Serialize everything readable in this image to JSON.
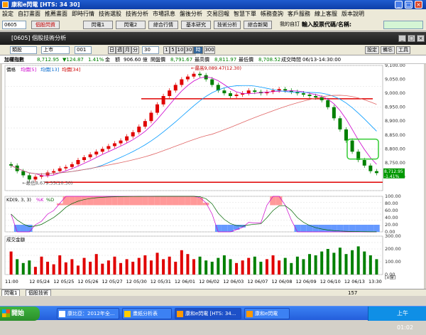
{
  "window": {
    "title": "康和e閃電 [HTS: 34 30]"
  },
  "menu": [
    "設定",
    "自訂畫面",
    "推薦畫面",
    "即時行情",
    "技術選股",
    "技術分析",
    "市場訊息",
    "盤後分析",
    "交易回報",
    "智慧下單",
    "帳務查詢",
    "客戶服務",
    "線上客服",
    "版本說明"
  ],
  "toolbar": {
    "stock_code": "0605",
    "buttons": [
      "個股閃資",
      "閃電1",
      "閃電2",
      "綜合行情",
      "基本研究",
      "技術分析",
      "綜合新聞",
      "我的自訂"
    ],
    "search_label": "輸入股票代碼/名稱:"
  },
  "subwin": {
    "title": "[0605] 個股技術分析"
  },
  "controls": {
    "type": "類股",
    "market": "上市",
    "code": "001",
    "periods": [
      "日",
      "週",
      "月",
      "分"
    ],
    "minutes": "30",
    "intervals": [
      "1",
      "5",
      "10",
      "30"
    ],
    "interval_active": "時間",
    "count": "300",
    "right_buttons": [
      "設定",
      "備忘",
      "工具"
    ]
  },
  "info": {
    "name": "加權指數",
    "price": "8,712.95",
    "change": "▼124.87",
    "pct": "1.41%",
    "amount_label": "金　額",
    "amount": "906.60 億",
    "open_label": "開盤價",
    "open": "8,791.67",
    "high_label": "最高價",
    "high": "8,811.97",
    "low_label": "最低價",
    "low": "8,708.52",
    "time_label": "成交時間",
    "time": "06/13-14:30:00"
  },
  "chart_data": {
    "type": "line",
    "panels": [
      {
        "name": "價格",
        "legend": [
          "均價[5]",
          "均價[13]",
          "均價[34]"
        ],
        "ylim": [
          8650,
          9100
        ],
        "yticks": [
          "9,100.00",
          "9,050.00",
          "9,000.00",
          "8,950.00",
          "8,900.00",
          "8,850.00",
          "8,800.00",
          "8,750.00",
          "8,700.00"
        ],
        "annotations": [
          "最高9,089.47(12.30)",
          "最低8,679.35(10.30)"
        ],
        "current_price": "8,712.95",
        "current_change": "-1.41%",
        "support_line": 8680,
        "resistance_line": 8980
      },
      {
        "name": "KD(9, 3, 3)",
        "legend": [
          "%K",
          "%D"
        ],
        "yticks": [
          "100.00",
          "80.00",
          "60.00",
          "40.00",
          "20.00",
          "0.00"
        ]
      },
      {
        "name": "成交金額",
        "yticks": [
          "300.00",
          "200.00",
          "100.00",
          "0.00"
        ],
        "unit": "[x億]"
      }
    ],
    "x": [
      "11:00",
      "12 05/24",
      "12 05/25",
      "12 05/26",
      "12 05/27",
      "12 05/30",
      "12 05/31",
      "12 06/01",
      "12 06/02",
      "12 06/03",
      "12 06/07",
      "12 06/08",
      "12 06/09",
      "12 06/10",
      "12 06/13",
      "13:30"
    ],
    "close": [
      8740,
      8720,
      8705,
      8690,
      8700,
      8705,
      8715,
      8720,
      8730,
      8735,
      8745,
      8760,
      8770,
      8780,
      8790,
      8800,
      8810,
      8820,
      8830,
      8845,
      8860,
      8880,
      8900,
      8930,
      8960,
      8990,
      9010,
      9030,
      9050,
      9060,
      9070,
      9065,
      9050,
      9030,
      9010,
      9000,
      8990,
      8995,
      9000,
      9010,
      9005,
      9000,
      9005,
      9010,
      9015,
      9010,
      9005,
      9000,
      8995,
      8990,
      8985,
      8975,
      8950,
      8910,
      8870,
      8830,
      8790,
      8760,
      8740,
      8720,
      8713
    ],
    "volume": [
      180,
      120,
      90,
      110,
      60,
      140,
      100,
      80,
      150,
      95,
      120,
      70,
      130,
      100,
      160,
      85,
      110,
      140,
      90,
      120,
      100,
      130,
      150,
      110,
      170,
      120,
      140,
      100,
      190,
      160,
      120,
      140,
      110,
      100,
      130,
      150,
      120,
      90,
      110,
      130,
      140,
      100,
      120,
      150,
      110,
      130,
      90,
      140,
      120,
      160,
      150,
      180,
      200,
      170,
      210,
      160,
      190,
      220,
      180,
      150,
      120
    ]
  },
  "status": {
    "tab1": "閃電1",
    "tab2": "個股技術",
    "page": "157"
  },
  "taskbar": {
    "start": "開始",
    "tasks": [
      "康比亞：2012年全...",
      "畫紙分析表",
      "康和e閃電 [HTS: 34...",
      "康和e閃電"
    ],
    "clock": "上午 01:02"
  }
}
